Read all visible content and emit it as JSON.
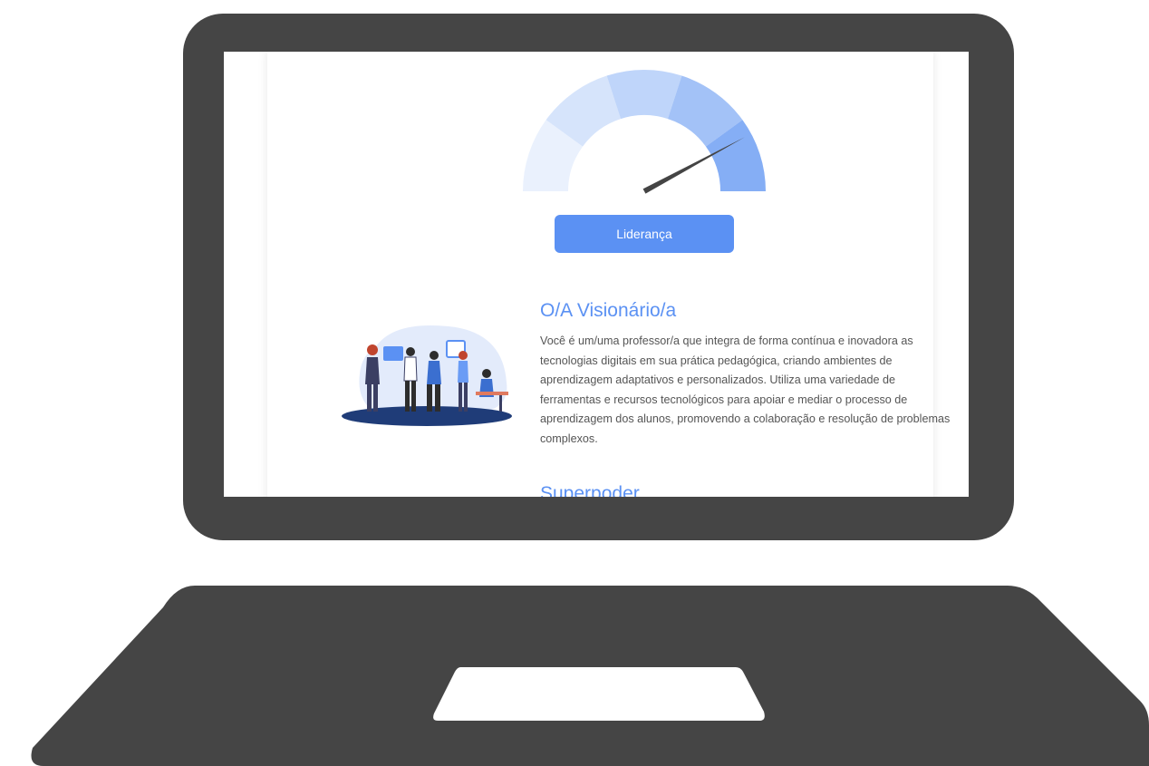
{
  "gauge": {
    "level_label": "Liderança",
    "level_index": 5,
    "level_count": 5,
    "segment_colors": [
      "#eaf1fd",
      "#d6e4fb",
      "#bfd5fa",
      "#a3c2f7",
      "#85aef5"
    ],
    "needle_color": "#444444"
  },
  "profile": {
    "title": "O/A Visionário/a",
    "description": "Você é um/uma professor/a que integra de forma contínua e inovadora as tecnologias digitais em sua prática pedagógica, criando ambientes de aprendizagem adaptativos e personalizados. Utiliza uma variedade de ferramentas e recursos tecnológicos para apoiar e mediar o processo de aprendizagem dos alunos, promovendo a colaboração e resolução de problemas complexos."
  },
  "next_section": {
    "title": "Superpoder"
  },
  "colors": {
    "accent": "#5b91f3",
    "laptop": "#454545",
    "text": "#555555"
  }
}
